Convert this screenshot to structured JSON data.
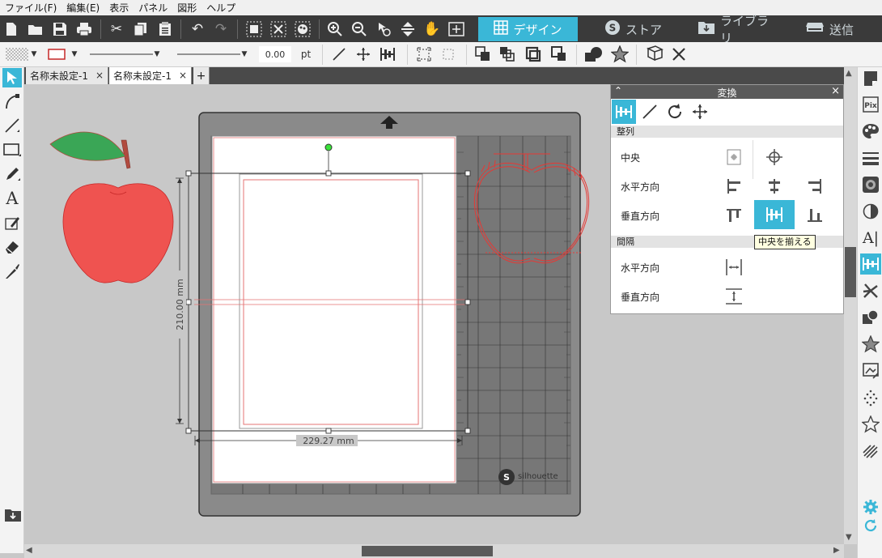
{
  "menu": [
    "ファイル(F)",
    "編集(E)",
    "表示",
    "パネル",
    "図形",
    "ヘルプ"
  ],
  "modes": {
    "design": "デザイン",
    "store": "ストア",
    "library": "ライブラリ",
    "send": "送信"
  },
  "toolbar2": {
    "line_thickness": "0.00",
    "unit": "pt"
  },
  "doc_tabs": [
    {
      "label": "名称未設定-1"
    },
    {
      "label": "名称未設定-1"
    }
  ],
  "add_tab": "+",
  "selection": {
    "height_label": "210.00 mm",
    "width_label": "229.27 mm"
  },
  "mat": {
    "brand": "silhouette"
  },
  "panel": {
    "title": "変換",
    "align_section": "整列",
    "center_label": "中央",
    "horizontal_label": "水平方向",
    "vertical_label": "垂直方向",
    "spacing_section": "間隔",
    "spacing_horizontal_label": "水平方向",
    "spacing_vertical_label": "垂直方向",
    "tooltip": "中央を揃える"
  },
  "colors": {
    "accent": "#3ab7d7",
    "apple_red": "#ef5350",
    "leaf_green": "#3aa656",
    "stem": "#b14b3f"
  }
}
